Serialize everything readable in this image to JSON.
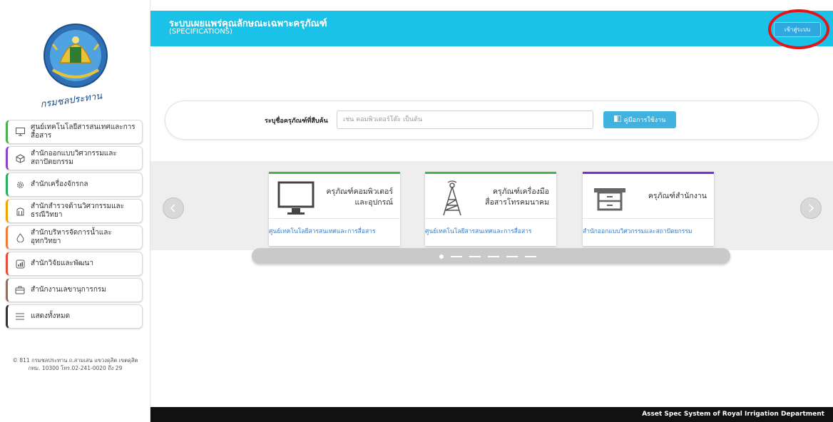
{
  "header": {
    "title": "ระบบเผยแพร่คุณลักษณะเฉพาะครุภัณฑ์",
    "subtitle": "(SPECIFICATIONS)",
    "login_label": "เข้าสู่ระบบ"
  },
  "logo": {
    "text": "กรมชลประทาน",
    "icon": "royal-irrigation-department-seal"
  },
  "sidebar": {
    "items": [
      {
        "label": "ศูนย์เทคโนโลยีสารสนเทศและการสื่อสาร",
        "icon": "monitor-icon",
        "color": "#4caf50"
      },
      {
        "label": "สำนักออกแบบวิศวกรรมและสถาปัตยกรรม",
        "icon": "cube-icon",
        "color": "#8e44c7"
      },
      {
        "label": "สำนักเครื่องจักรกล",
        "icon": "gear-icon",
        "color": "#27ae60"
      },
      {
        "label": "สำนักสำรวจด้านวิศวกรรมและธรณีวิทยา",
        "icon": "survey-icon",
        "color": "#f0a500"
      },
      {
        "label": "สำนักบริหารจัดการน้ำและอุทกวิทยา",
        "icon": "water-drop-icon",
        "color": "#f07c3c"
      },
      {
        "label": "สำนักวิจัยและพัฒนา",
        "icon": "chart-box-icon",
        "color": "#e74c3c"
      },
      {
        "label": "สำนักงานเลขานุการกรม",
        "icon": "briefcase-icon",
        "color": "#8d6e63"
      },
      {
        "label": "แสดงทั้งหมด",
        "icon": "menu-lines-icon",
        "color": "#333333"
      }
    ],
    "copyright_line1": "© 811 กรมชลประทาน ถ.สามเสน แขวงดุสิต เขตดุสิต",
    "copyright_line2": "กทม. 10300 โทร.02-241-0020 ถึง 29"
  },
  "search": {
    "label": "ระบุชื่อครุภัณฑ์ที่สืบค้น",
    "placeholder": "เช่น คอมพิวเตอร์โต๊ะ เป็นต้น",
    "value": "",
    "manual_label": "คู่มือการใช้งาน"
  },
  "carousel": {
    "cards": [
      {
        "title_line1": "ครุภัณฑ์คอมพิวเตอร์",
        "title_line2": "และอุปกรณ์",
        "link": "ศูนย์เทคโนโลยีสารสนเทศและการสื่อสาร",
        "accent": "#4caf50",
        "icon": "computer-monitor-icon"
      },
      {
        "title_line1": "ครุภัณฑ์เครื่องมือ",
        "title_line2": "สื่อสารโทรคมนาคม",
        "link": "ศูนย์เทคโนโลยีสารสนเทศและการสื่อสาร",
        "accent": "#4caf50",
        "icon": "antenna-tower-icon"
      },
      {
        "title_line1": "ครุภัณฑ์สำนักงาน",
        "title_line2": "",
        "link": "สำนักออกแบบวิศวกรรมและสถาปัตยกรรม",
        "accent": "#7b2fd0",
        "icon": "office-cabinet-icon"
      }
    ],
    "pagination_active": 1
  },
  "footer": {
    "text": "Asset Spec System of Royal Irrigation Department"
  },
  "colors": {
    "header_bg": "#19c2e6",
    "login_btn": "#2ea8df",
    "highlight_ring": "#e5141b",
    "footer_bg": "#111111"
  }
}
